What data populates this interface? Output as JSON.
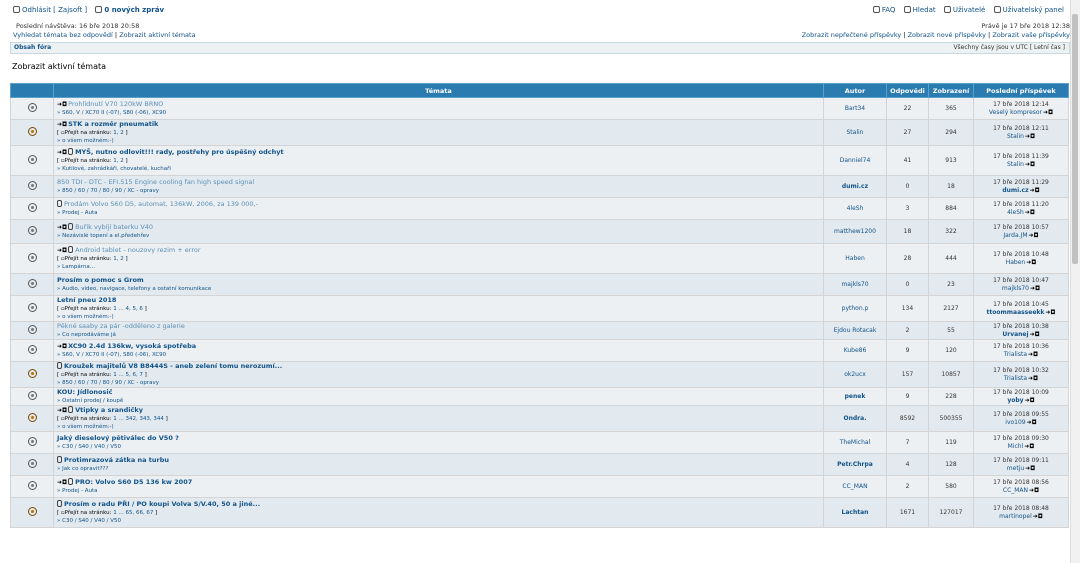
{
  "header": {
    "logout": "Odhlásit [ Zajsoft ]",
    "messages": "0 nových zpráv",
    "faq": "FAQ",
    "search": "Hledat",
    "users": "Uživatelé",
    "panel": "Uživatelský panel",
    "last_visit": "Poslední návštěva: 16 bře 2018 20:58",
    "current_time": "Právě je 17 bře 2018 12:38",
    "link_unanswered": "Vyhledat témata bez odpovědí",
    "link_active": "Zobrazit aktivní témata",
    "link_unread": "Zobrazit nepřečtené příspěvky",
    "link_new": "Zobrazit nové příspěvky",
    "link_yours": "Zobrazit vaše příspěvky",
    "sep": "|"
  },
  "crumb": {
    "index": "Obsah fóra",
    "timezone": "Všechny časy jsou v UTC [ Letní čas ]"
  },
  "page_title": "Zobrazit aktivní témata",
  "columns": {
    "topics": "Témata",
    "author": "Autor",
    "replies": "Odpovědi",
    "views": "Zobrazení",
    "last_post": "Poslední příspěvek"
  },
  "pages_prefix": "Přejít na stránku:",
  "topics": [
    {
      "title": "Prohlídnutí V70 120kW BRNO",
      "new": true,
      "attach": false,
      "read": true,
      "pages": "",
      "cat": "S60, V / XC70 II (-07), S80 (-06), XC90",
      "author": "Bart34",
      "author_bold": false,
      "replies": "22",
      "views": "365",
      "last_date": "17 bře 2018 12:14",
      "last_by": "Veselý kompresor",
      "last_bold": false,
      "hot": false
    },
    {
      "title": "STK a rozměr pneumatik",
      "new": true,
      "attach": false,
      "read": false,
      "pages": "1, 2",
      "cat": "o všem možném:-)",
      "author": "Stalin",
      "author_bold": false,
      "replies": "27",
      "views": "294",
      "last_date": "17 bře 2018 12:11",
      "last_by": "Stalin",
      "last_bold": false,
      "hot": true
    },
    {
      "title": "MYŠ, nutno odlovit!!! rady, postřehy pro úspěšný odchyt",
      "new": true,
      "attach": true,
      "read": false,
      "pages": "1, 2",
      "cat": "Kutilové, zahrádkáři, chovatelé, kuchaři",
      "author": "Danniel74",
      "author_bold": false,
      "replies": "41",
      "views": "913",
      "last_date": "17 bře 2018 11:39",
      "last_by": "Stalin",
      "last_bold": false,
      "hot": false
    },
    {
      "title": "850 TDI - DTC - EFI.515 Engine cooling fan high speed signal",
      "new": false,
      "attach": false,
      "read": true,
      "pages": "",
      "cat": "850 / 60 / 70 / 80 / 90 / XC - opravy",
      "author": "dumi.cz",
      "author_bold": true,
      "replies": "0",
      "views": "18",
      "last_date": "17 bře 2018 11:29",
      "last_by": "dumi.cz",
      "last_bold": true,
      "hot": false
    },
    {
      "title": "Prodám Volvo S60 D5, automat, 136kW, 2006, za 139 000,-",
      "new": false,
      "attach": true,
      "read": true,
      "pages": "",
      "cat": "Prodej - Auta",
      "author": "4leSh",
      "author_bold": false,
      "replies": "3",
      "views": "884",
      "last_date": "17 bře 2018 11:20",
      "last_by": "4leSh",
      "last_bold": false,
      "hot": false
    },
    {
      "title": "Buřik vybíjí baterku V40",
      "new": true,
      "attach": true,
      "read": true,
      "pages": "",
      "cat": "Nezávislé topení a el.předehřev",
      "author": "matthew1200",
      "author_bold": false,
      "replies": "18",
      "views": "322",
      "last_date": "17 bře 2018 10:57",
      "last_by": "Jarda.JM",
      "last_bold": false,
      "hot": false
    },
    {
      "title": "Android tablet - nouzovy rezim + error",
      "new": true,
      "attach": true,
      "read": true,
      "pages": "1, 2",
      "cat": "Lampárna...",
      "author": "Haben",
      "author_bold": false,
      "replies": "28",
      "views": "444",
      "last_date": "17 bře 2018 10:48",
      "last_by": "Haben",
      "last_bold": false,
      "hot": false
    },
    {
      "title": "Prosím o pomoc s Grom",
      "new": false,
      "attach": false,
      "read": false,
      "pages": "",
      "cat": "Audio, video, navigace, telefony a ostatní komunikace",
      "author": "majkls70",
      "author_bold": false,
      "replies": "0",
      "views": "23",
      "last_date": "17 bře 2018 10:47",
      "last_by": "majkls70",
      "last_bold": false,
      "hot": false
    },
    {
      "title": "Letní pneu 2018",
      "new": false,
      "attach": false,
      "read": false,
      "pages": "1 ... 4, 5, 6",
      "cat": "o všem možném:-)",
      "author": "python.p",
      "author_bold": false,
      "replies": "134",
      "views": "2127",
      "last_date": "17 bře 2018 10:45",
      "last_by": "ttoommaasseekk",
      "last_bold": true,
      "hot": false
    },
    {
      "title": "Pěkné saaby za pár -odděleno z galerie",
      "new": false,
      "attach": false,
      "read": true,
      "pages": "",
      "cat": "Co neprodáváme já",
      "author": "Ejdou Rotacak",
      "author_bold": false,
      "replies": "2",
      "views": "55",
      "last_date": "17 bře 2018 10:38",
      "last_by": "Urvanej",
      "last_bold": true,
      "hot": false
    },
    {
      "title": "XC90 2.4d 136kw, vysoká spotřeba",
      "new": true,
      "attach": false,
      "read": false,
      "pages": "",
      "cat": "S60, V / XC70 II (-07), S80 (-06), XC90",
      "author": "Kube86",
      "author_bold": false,
      "replies": "9",
      "views": "120",
      "last_date": "17 bře 2018 10:36",
      "last_by": "Trialista",
      "last_bold": false,
      "hot": false
    },
    {
      "title": "Kroužek majitelů V8 B8444S - aneb zelení tomu nerozumí...",
      "new": false,
      "attach": true,
      "read": false,
      "pages": "1 ... 5, 6, 7",
      "cat": "850 / 60 / 70 / 80 / 90 / XC - opravy",
      "author": "ok2ucx",
      "author_bold": false,
      "replies": "157",
      "views": "10857",
      "last_date": "17 bře 2018 10:32",
      "last_by": "Trialista",
      "last_bold": false,
      "hot": true
    },
    {
      "title": "KOU: Jídlonosič",
      "new": false,
      "attach": false,
      "read": false,
      "pages": "",
      "cat": "Ostatní prodej / koupě",
      "author": "penek",
      "author_bold": true,
      "replies": "9",
      "views": "228",
      "last_date": "17 bře 2018 10:09",
      "last_by": "yoby",
      "last_bold": true,
      "hot": false
    },
    {
      "title": "Vtipky a srandičky",
      "new": true,
      "attach": true,
      "read": false,
      "pages": "1 ... 342, 343, 344",
      "cat": "o všem možném:-)",
      "author": "Ondra.",
      "author_bold": true,
      "replies": "8592",
      "views": "500355",
      "last_date": "17 bře 2018 09:55",
      "last_by": "ivo109",
      "last_bold": false,
      "hot": true
    },
    {
      "title": "Jaký dieselový pětiválec do V50 ?",
      "new": false,
      "attach": false,
      "read": false,
      "pages": "",
      "cat": "C30 / S40 / V40 / V50",
      "author": "TheMichal",
      "author_bold": false,
      "replies": "7",
      "views": "119",
      "last_date": "17 bře 2018 09:30",
      "last_by": "Michl",
      "last_bold": false,
      "hot": false
    },
    {
      "title": "Protimrazová zátka na turbu",
      "new": false,
      "attach": true,
      "read": false,
      "pages": "",
      "cat": "Jak co opravit???",
      "author": "Petr.Chrpa",
      "author_bold": true,
      "replies": "4",
      "views": "128",
      "last_date": "17 bře 2018 09:11",
      "last_by": "metju",
      "last_bold": false,
      "hot": false
    },
    {
      "title": "PRO: Volvo S60 D5 136 kw 2007",
      "new": true,
      "attach": true,
      "read": false,
      "pages": "",
      "cat": "Prodej - Auta",
      "author": "CC_MAN",
      "author_bold": false,
      "replies": "2",
      "views": "580",
      "last_date": "17 bře 2018 08:56",
      "last_by": "CC_MAN",
      "last_bold": false,
      "hot": false
    },
    {
      "title": "Prosím o radu PŘI / PO koupi Volva S/V.40, 50 a jiné...",
      "new": false,
      "attach": true,
      "read": false,
      "pages": "1 ... 65, 66, 67",
      "cat": "C30 / S40 / V40 / V50",
      "author": "Lachtan",
      "author_bold": true,
      "replies": "1671",
      "views": "127017",
      "last_date": "17 bře 2018 08:48",
      "last_by": "martinopel",
      "last_bold": false,
      "hot": true
    }
  ]
}
